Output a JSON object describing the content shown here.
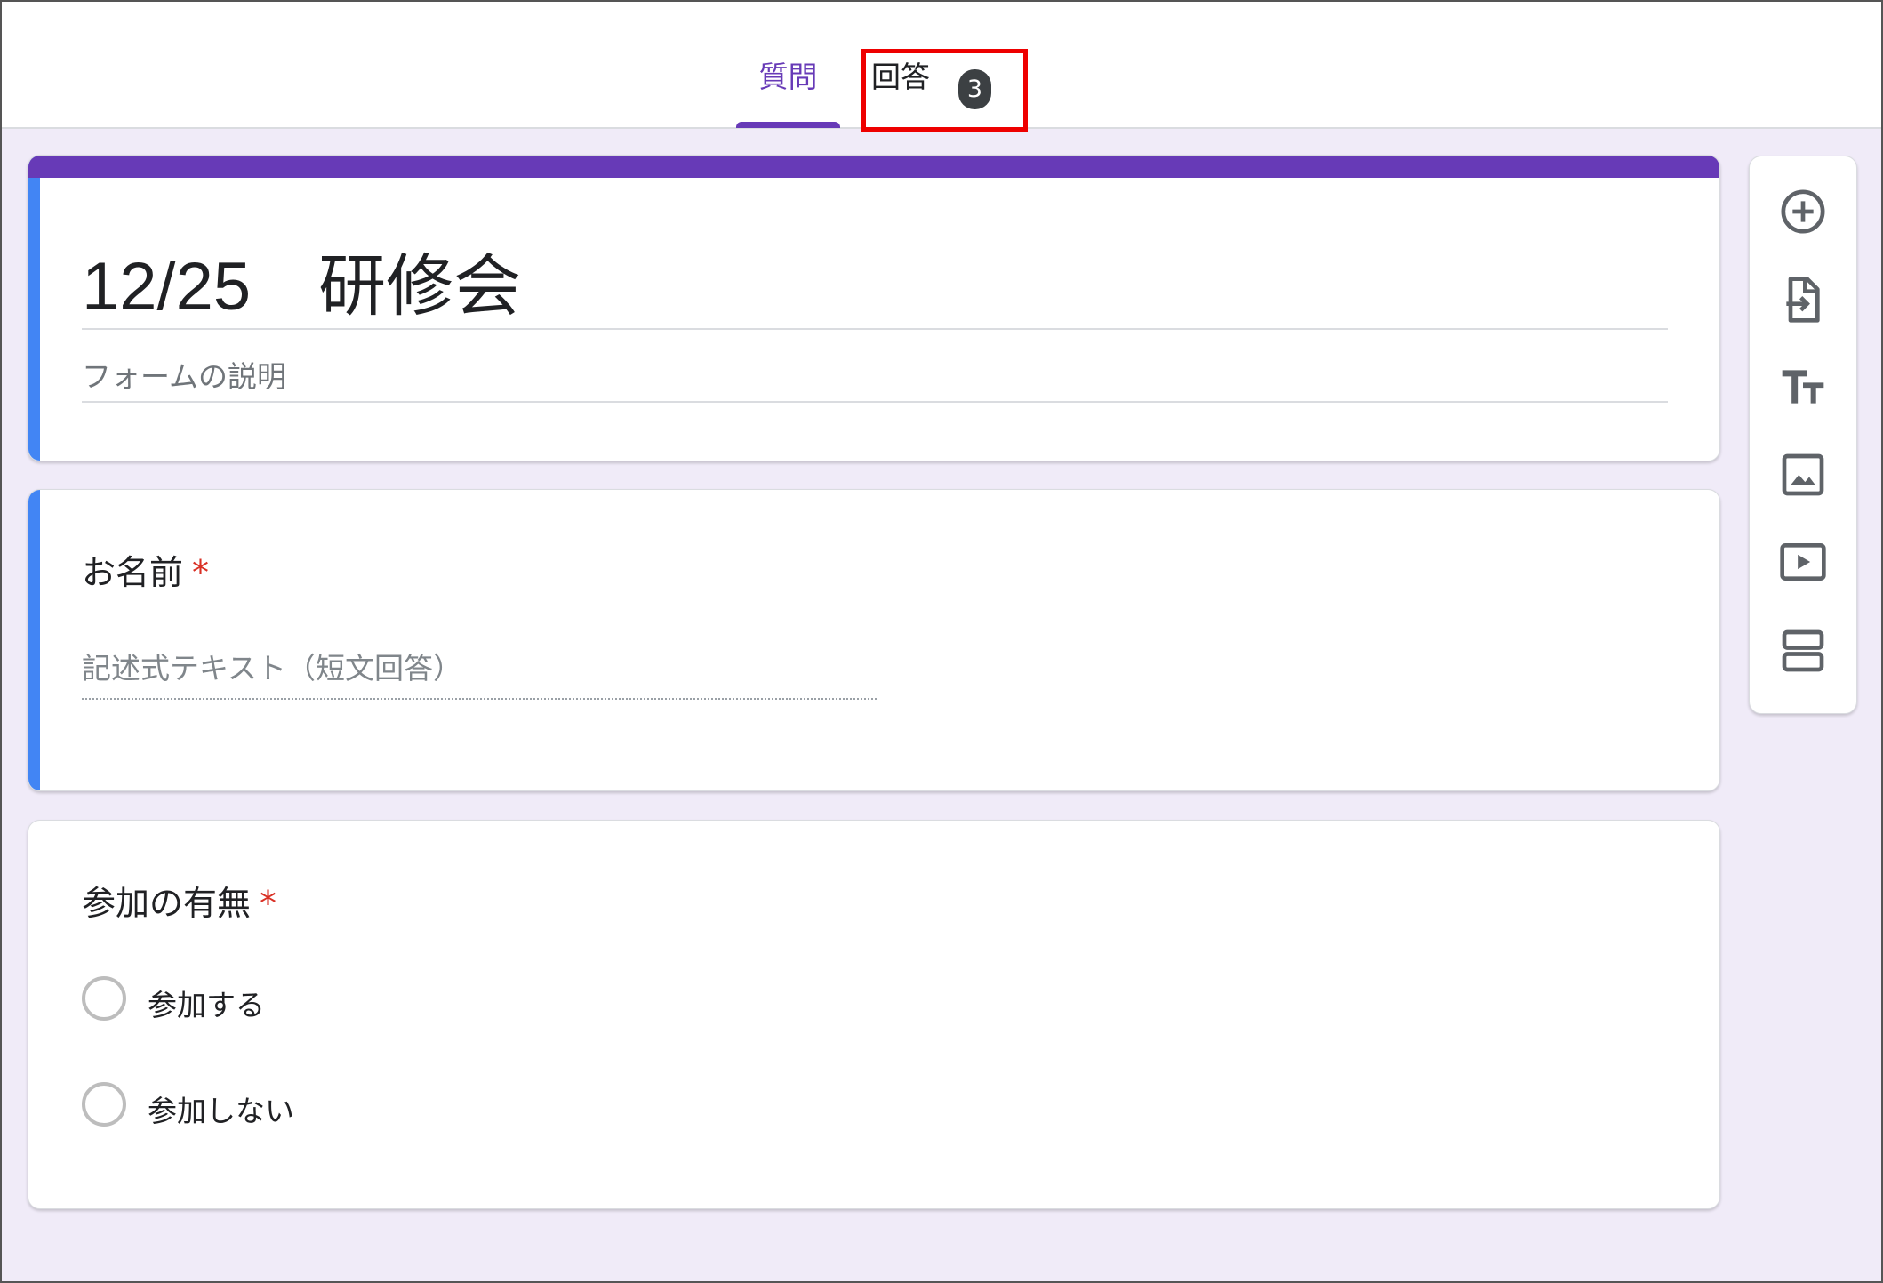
{
  "header": {
    "tabs": [
      {
        "label": "質問",
        "active": true
      },
      {
        "label": "回答",
        "active": false,
        "badge": "3"
      }
    ]
  },
  "form": {
    "title": "12/25　研修会",
    "description_placeholder": "フォームの説明"
  },
  "questions": [
    {
      "title": "お名前",
      "required_mark": "*",
      "type": "short-answer",
      "placeholder": "記述式テキスト（短文回答）"
    },
    {
      "title": "参加の有無",
      "required_mark": "*",
      "type": "multiple-choice",
      "options": [
        "参加する",
        "参加しない"
      ]
    }
  ],
  "toolbar": {
    "items": [
      "add-question-icon",
      "import-questions-icon",
      "add-title-icon",
      "add-image-icon",
      "add-video-icon",
      "add-section-icon"
    ]
  },
  "colors": {
    "accent": "#673ab7",
    "active_card_bar": "#4285f4",
    "background": "#f0ebf8",
    "required": "#d93025",
    "highlight": "#ee0000"
  }
}
